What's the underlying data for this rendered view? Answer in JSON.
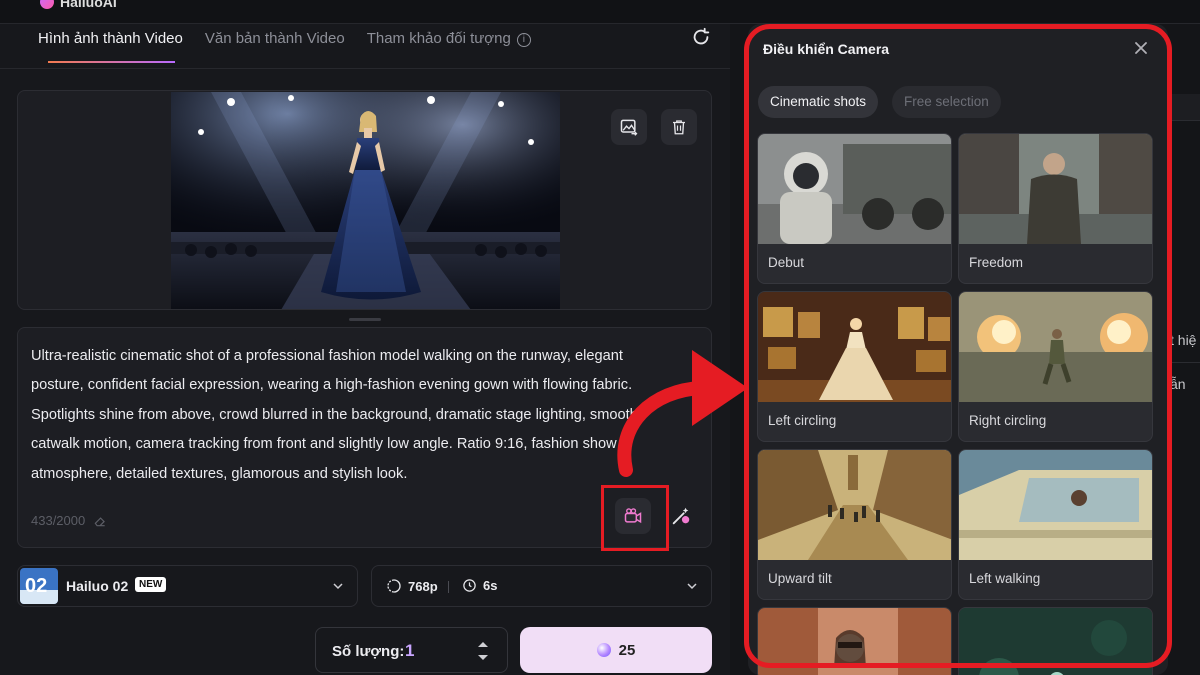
{
  "app": {
    "logo_text": "HailuoAI"
  },
  "tabs": [
    {
      "label": "Hình ảnh thành Video"
    },
    {
      "label": "Văn bản thành Video"
    },
    {
      "label": "Tham khảo đối tượng"
    }
  ],
  "prompt": {
    "lines": [
      "Ultra-realistic cinematic shot of a professional fashion model walking on the runway, elegant",
      "posture, confident facial expression, wearing a high-fashion evening gown with flowing fabric.",
      "Spotlights shine from above, crowd blurred in the background, dramatic stage lighting, smooth",
      "catwalk motion, camera tracking from front and slightly low angle. Ratio 9:16, fashion show",
      "atmosphere, detailed textures, glamorous and stylish look."
    ],
    "char_count": "433/2000"
  },
  "model": {
    "name": "Hailuo 02",
    "badge": "NEW",
    "thumb_text": "02"
  },
  "settings": {
    "resolution": "768p",
    "duration": "6s"
  },
  "quantity": {
    "label": "Số lượng:",
    "value": "1"
  },
  "generate": {
    "cost": "25"
  },
  "camera_panel": {
    "title": "Điều khiển Camera",
    "chips": [
      {
        "label": "Cinematic shots"
      },
      {
        "label": "Free selection"
      }
    ],
    "shots": [
      {
        "label": "Debut"
      },
      {
        "label": "Freedom"
      },
      {
        "label": "Left circling"
      },
      {
        "label": "Right circling"
      },
      {
        "label": "Upward tilt"
      },
      {
        "label": "Left walking"
      }
    ]
  },
  "background_fragments": {
    "frag1": "t hiệ",
    "frag2": "ẫn"
  },
  "colors": {
    "accent_red": "#e51c23",
    "quantity_value": "#c9a6ff",
    "generate_bg": "#f1def6"
  }
}
